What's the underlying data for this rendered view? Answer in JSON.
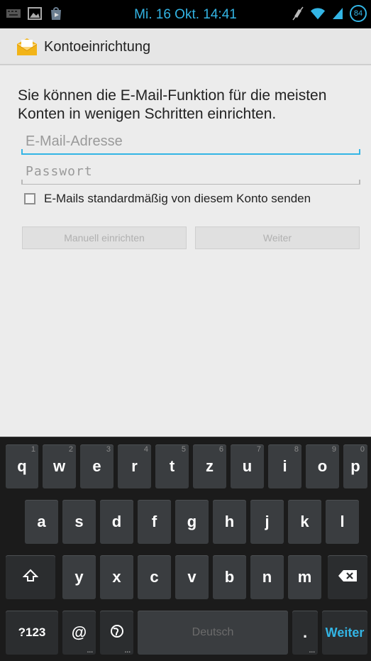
{
  "status_bar": {
    "time": "Mi. 16 Okt. 14:41",
    "battery": "84",
    "accent_color": "#33b5e5",
    "left_icons": [
      "keyboard-icon",
      "image-icon",
      "play-store-icon"
    ],
    "right_icons": [
      "mute-icon",
      "wifi-icon",
      "signal-icon",
      "battery-icon"
    ]
  },
  "action_bar": {
    "title": "Kontoeinrichtung",
    "icon": "email-app-icon"
  },
  "form": {
    "intro": "Sie können die E-Mail-Funktion für die meisten Konten in wenigen Schritten einrichten.",
    "email_placeholder": "E-Mail-Adresse",
    "email_value": "",
    "password_placeholder": "Passwort",
    "password_value": "",
    "checkbox_label": "E-Mails standardmäßig von diesem Konto senden",
    "checkbox_checked": false,
    "manual_button": "Manuell einrichten",
    "next_button": "Weiter"
  },
  "keyboard": {
    "row1": [
      {
        "key": "q",
        "hint": "1"
      },
      {
        "key": "w",
        "hint": "2"
      },
      {
        "key": "e",
        "hint": "3"
      },
      {
        "key": "r",
        "hint": "4"
      },
      {
        "key": "t",
        "hint": "5"
      },
      {
        "key": "z",
        "hint": "6"
      },
      {
        "key": "u",
        "hint": "7"
      },
      {
        "key": "i",
        "hint": "8"
      },
      {
        "key": "o",
        "hint": "9"
      },
      {
        "key": "p",
        "hint": "0"
      }
    ],
    "row2": [
      "a",
      "s",
      "d",
      "f",
      "g",
      "h",
      "j",
      "k",
      "l"
    ],
    "row3": [
      "y",
      "x",
      "c",
      "v",
      "b",
      "n",
      "m"
    ],
    "symbols_key": "?123",
    "at_key": "@",
    "space_label": "Deutsch",
    "period_key": ".",
    "action_key": "Weiter"
  }
}
